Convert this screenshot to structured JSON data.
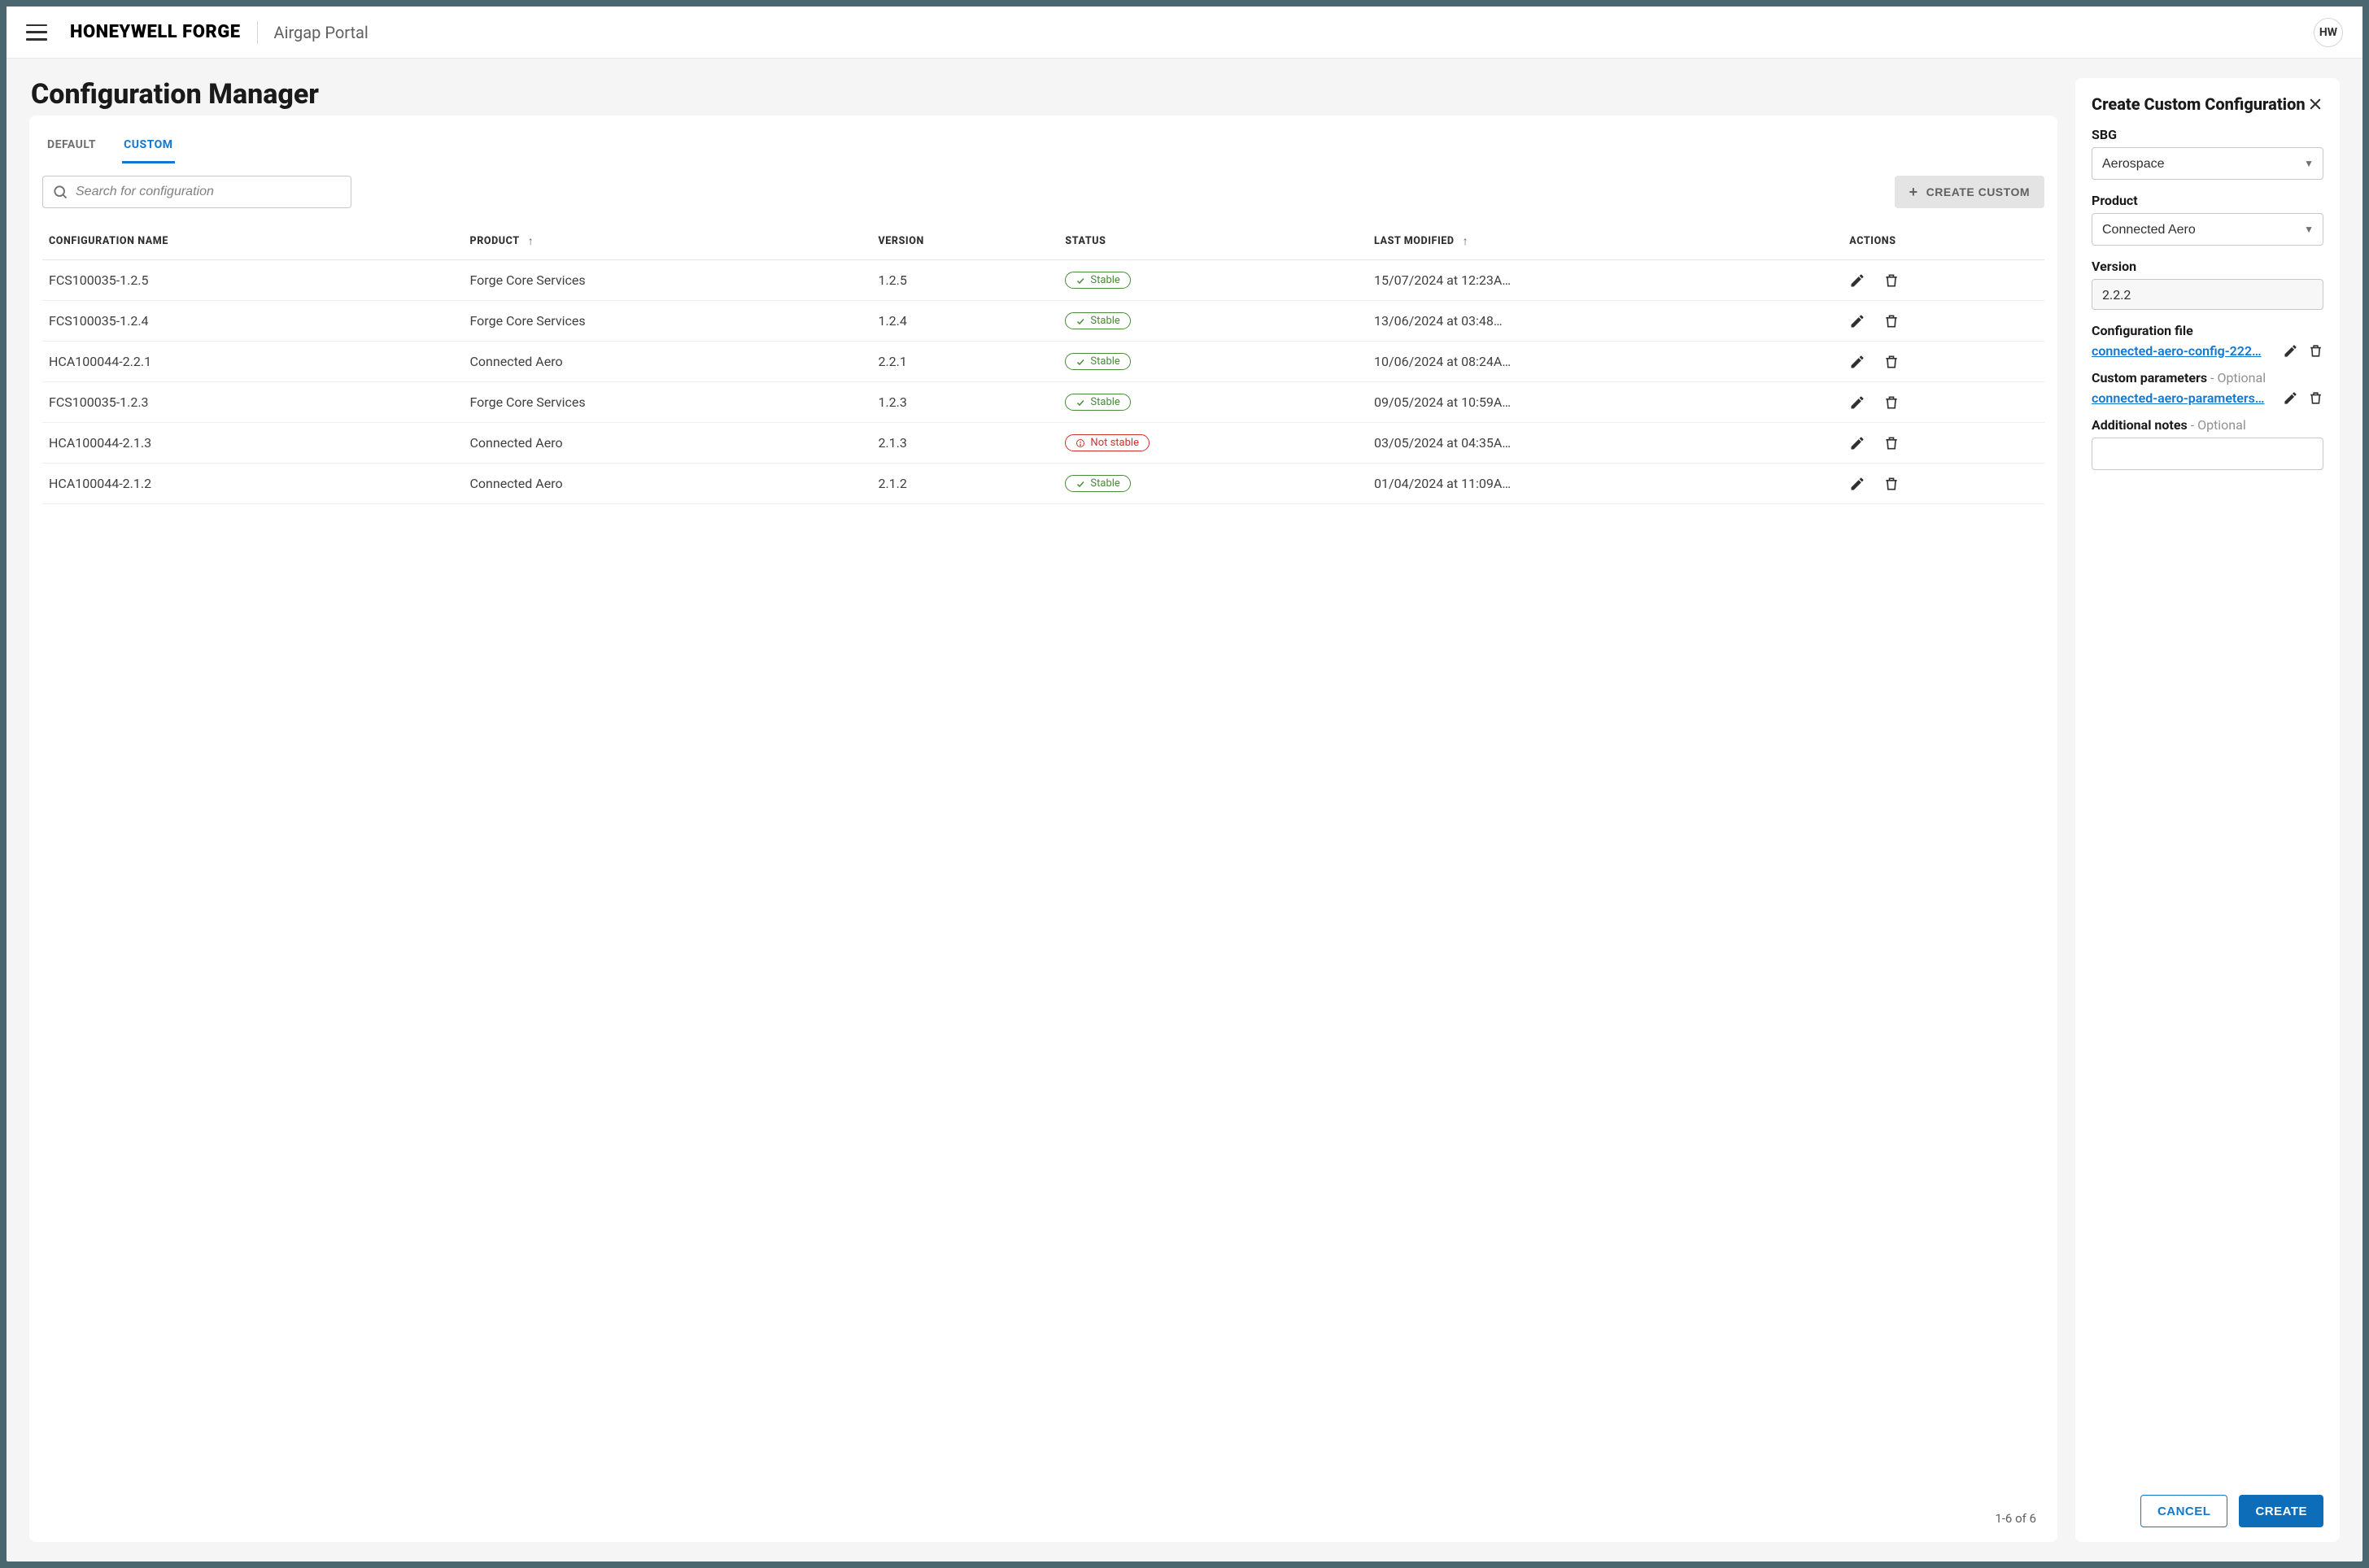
{
  "header": {
    "brand": "HONEYWELL FORGE",
    "subbrand": "Airgap Portal",
    "avatar": "HW"
  },
  "pageTitle": "Configuration Manager",
  "tabs": {
    "default": "DEFAULT",
    "custom": "CUSTOM"
  },
  "search": {
    "placeholder": "Search for configuration"
  },
  "createCustomBtn": "CREATE CUSTOM",
  "columns": {
    "name": "CONFIGURATION NAME",
    "product": "PRODUCT",
    "version": "VERSION",
    "status": "STATUS",
    "modified": "LAST MODIFIED",
    "actions": "ACTIONS"
  },
  "statusLabels": {
    "stable": "Stable",
    "notstable": "Not stable"
  },
  "rows": [
    {
      "name": "FCS100035-1.2.5",
      "product": "Forge Core Services",
      "version": "1.2.5",
      "status": "stable",
      "modified": "15/07/2024 at 12:23A…"
    },
    {
      "name": "FCS100035-1.2.4",
      "product": "Forge Core Services",
      "version": "1.2.4",
      "status": "stable",
      "modified": "13/06/2024 at 03:48…"
    },
    {
      "name": "HCA100044-2.2.1",
      "product": "Connected Aero",
      "version": "2.2.1",
      "status": "stable",
      "modified": "10/06/2024 at 08:24A…"
    },
    {
      "name": "FCS100035-1.2.3",
      "product": "Forge Core Services",
      "version": "1.2.3",
      "status": "stable",
      "modified": "09/05/2024 at 10:59A…"
    },
    {
      "name": "HCA100044-2.1.3",
      "product": "Connected Aero",
      "version": "2.1.3",
      "status": "notstable",
      "modified": "03/05/2024 at 04:35A…"
    },
    {
      "name": "HCA100044-2.1.2",
      "product": "Connected Aero",
      "version": "2.1.2",
      "status": "stable",
      "modified": "01/04/2024 at 11:09A…"
    }
  ],
  "pagination": "1-6 of 6",
  "panel": {
    "title": "Create Custom Configuration",
    "sbgLabel": "SBG",
    "sbgValue": "Aerospace",
    "productLabel": "Product",
    "productValue": "Connected Aero",
    "versionLabel": "Version",
    "versionValue": "2.2.2",
    "configFileLabel": "Configuration file",
    "configFileName": "connected-aero-config-222…",
    "customParamsLabel": "Custom parameters",
    "optionalText": " - Optional",
    "customParamsFile": "connected-aero-parameters…",
    "notesLabel": "Additional notes",
    "cancel": "CANCEL",
    "create": "CREATE"
  }
}
